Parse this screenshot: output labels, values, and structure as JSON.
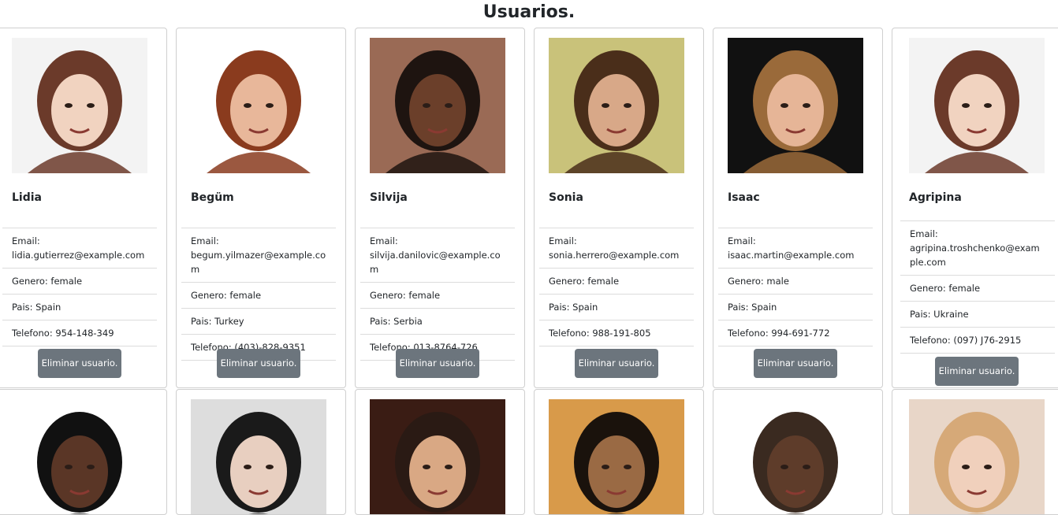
{
  "page": {
    "title": "Usuarios."
  },
  "users": [
    {
      "name": "Lidia",
      "email_label": "Email:",
      "email": "lidia.gutierrez@example.com",
      "gender": "Genero: female",
      "country": "Pais: Spain",
      "phone": "Telefono: 954-148-349",
      "button": "Eliminar usuario.",
      "skin": "#f1d3c0",
      "hair": "#6b3a2a",
      "bg": "#f3f3f3"
    },
    {
      "name": "Begüm",
      "email_label": "Email:",
      "email": "begum.yilmazer@example.com",
      "gender": "Genero: female",
      "country": "Pais: Turkey",
      "phone": "Telefono: (403)-828-9351",
      "button": "Eliminar usuario.",
      "skin": "#e8b79a",
      "hair": "#8a3b1e",
      "bg": "#ffffff"
    },
    {
      "name": "Silvija",
      "email_label": "Email:",
      "email": "silvija.danilovic@example.com",
      "gender": "Genero: female",
      "country": "Pais: Serbia",
      "phone": "Telefono: 013-8764-726",
      "button": "Eliminar usuario.",
      "skin": "#6b3f2a",
      "hair": "#1e1410",
      "bg": "#9a6a55"
    },
    {
      "name": "Sonia",
      "email_label": "Email:",
      "email": "sonia.herrero@example.com",
      "gender": "Genero: female",
      "country": "Pais: Spain",
      "phone": "Telefono: 988-191-805",
      "button": "Eliminar usuario.",
      "skin": "#d8a888",
      "hair": "#4a2e1a",
      "bg": "#c9c27a"
    },
    {
      "name": "Isaac",
      "email_label": "Email:",
      "email": "isaac.martin@example.com",
      "gender": "Genero: male",
      "country": "Pais: Spain",
      "phone": "Telefono: 994-691-772",
      "button": "Eliminar usuario.",
      "skin": "#e6b597",
      "hair": "#9a6a3a",
      "bg": "#111111"
    },
    {
      "name": "Agripina",
      "email_label": "Email:",
      "email": "agripina.troshchenko@example.com",
      "gender": "Genero: female",
      "country": "Pais: Ukraine",
      "phone": "Telefono: (097) J76-2915",
      "button": "Eliminar usuario.",
      "skin": "#f1d3c0",
      "hair": "#6b3a2a",
      "bg": "#f3f3f3"
    },
    {
      "skin": "#5a3626",
      "hair": "#111111",
      "bg": "#ffffff"
    },
    {
      "skin": "#e8cfc0",
      "hair": "#1a1a1a",
      "bg": "#dddddd"
    },
    {
      "skin": "#d9a884",
      "hair": "#2a1a14",
      "bg": "#3a1c14"
    },
    {
      "skin": "#9a6a44",
      "hair": "#1a120c",
      "bg": "#d89a4a"
    },
    {
      "skin": "#5e3c2a",
      "hair": "#3a2a20",
      "bg": "#ffffff"
    },
    {
      "skin": "#f0d0bc",
      "hair": "#d6a978",
      "bg": "#e8d6c8"
    }
  ]
}
